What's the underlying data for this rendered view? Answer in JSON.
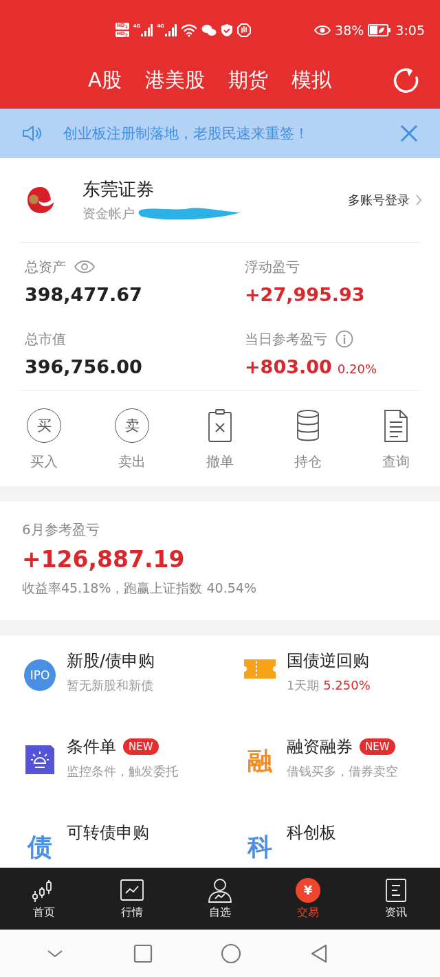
{
  "status_bar": {
    "hd_badges": [
      {
        "label": "HD",
        "sim": "1"
      },
      {
        "label": "HD",
        "sim": "2"
      }
    ],
    "networks": [
      "4G",
      "4G"
    ],
    "battery_percent": "38%",
    "time": "3:05"
  },
  "market_tabs": [
    "A股",
    "港美股",
    "期货",
    "模拟"
  ],
  "banner": {
    "text": "创业板注册制落地，老股民速来重签！"
  },
  "account": {
    "broker": "东莞证券",
    "account_label": "资金帐户",
    "switch_link": "多账号登录"
  },
  "stats": [
    {
      "label": "总资产",
      "kind": "eye",
      "value": "398,477.67"
    },
    {
      "label": "浮动盈亏",
      "kind": "plain",
      "value": "+27,995.93"
    },
    {
      "label": "总市值",
      "kind": "plain",
      "value": "396,756.00"
    },
    {
      "label": "当日参考盈亏",
      "kind": "info",
      "value": "+803.00",
      "percent": "0.20%"
    }
  ],
  "actions": [
    {
      "label": "买入",
      "kind": "circle",
      "glyph": "买"
    },
    {
      "label": "卖出",
      "kind": "circle",
      "glyph": "卖"
    },
    {
      "label": "撤单",
      "kind": "cancel"
    },
    {
      "label": "持仓",
      "kind": "database"
    },
    {
      "label": "查询",
      "kind": "document"
    }
  ],
  "monthly": {
    "title": "6月参考盈亏",
    "value": "+126,887.19",
    "summary": "收益率45.18%，跑赢上证指数 40.54%"
  },
  "services": [
    {
      "title": "新股/债申购",
      "subtitle": "暂无新股和新债",
      "kind": "badge",
      "icon_text": "IPO",
      "color": "#4a90e2"
    },
    {
      "title": "国债逆回购",
      "subtitle": "1天期",
      "highlight": "5.250%",
      "kind": "ticket",
      "color": "#f7a21b"
    },
    {
      "title": "条件单",
      "badge": "NEW",
      "subtitle": "监控条件，触发委托",
      "kind": "alarm",
      "color": "#5553d6"
    },
    {
      "title": "融资融券",
      "badge": "NEW",
      "subtitle": "借钱买多，借券卖空",
      "kind": "glyph",
      "icon_text": "融",
      "color": "#f08a24"
    },
    {
      "title": "可转债申购",
      "kind": "glyph",
      "icon_text": "债",
      "color": "#4a90e2"
    },
    {
      "title": "科创板",
      "kind": "glyph",
      "icon_text": "科",
      "color": "#4a90e2"
    }
  ],
  "bottom_nav": [
    {
      "label": "首页",
      "kind": "candles",
      "selected": false
    },
    {
      "label": "行情",
      "kind": "chart",
      "selected": false
    },
    {
      "label": "自选",
      "kind": "person",
      "selected": false
    },
    {
      "label": "交易",
      "kind": "coin",
      "icon_text": "¥",
      "selected": true
    },
    {
      "label": "资讯",
      "kind": "news",
      "selected": false
    }
  ]
}
